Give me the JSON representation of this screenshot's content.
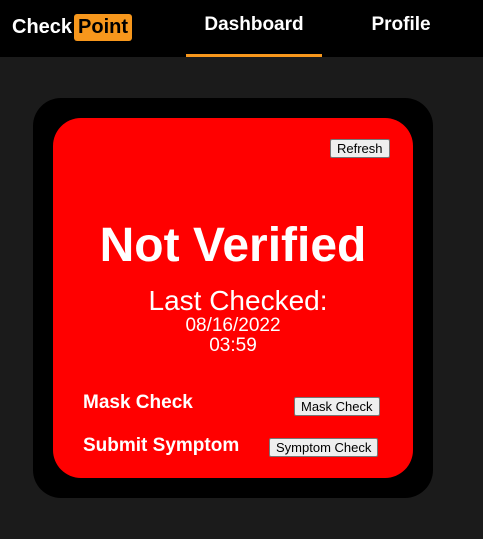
{
  "header": {
    "logo_part1": "Check",
    "logo_part2": "Point",
    "tabs": [
      {
        "label": "Dashboard",
        "active": true
      },
      {
        "label": "Profile",
        "active": false
      }
    ],
    "accent_color": "#f7971c"
  },
  "status_card": {
    "refresh_label": "Refresh",
    "status": "Not Verified",
    "status_color": "#ff0000",
    "last_checked_label": "Last Checked:",
    "last_checked_date": "08/16/2022",
    "last_checked_time": "03:59",
    "mask_check_label": "Mask Check",
    "mask_check_button": "Mask Check",
    "submit_symptom_label": "Submit Symptom",
    "symptom_check_button": "Symptom Check"
  }
}
